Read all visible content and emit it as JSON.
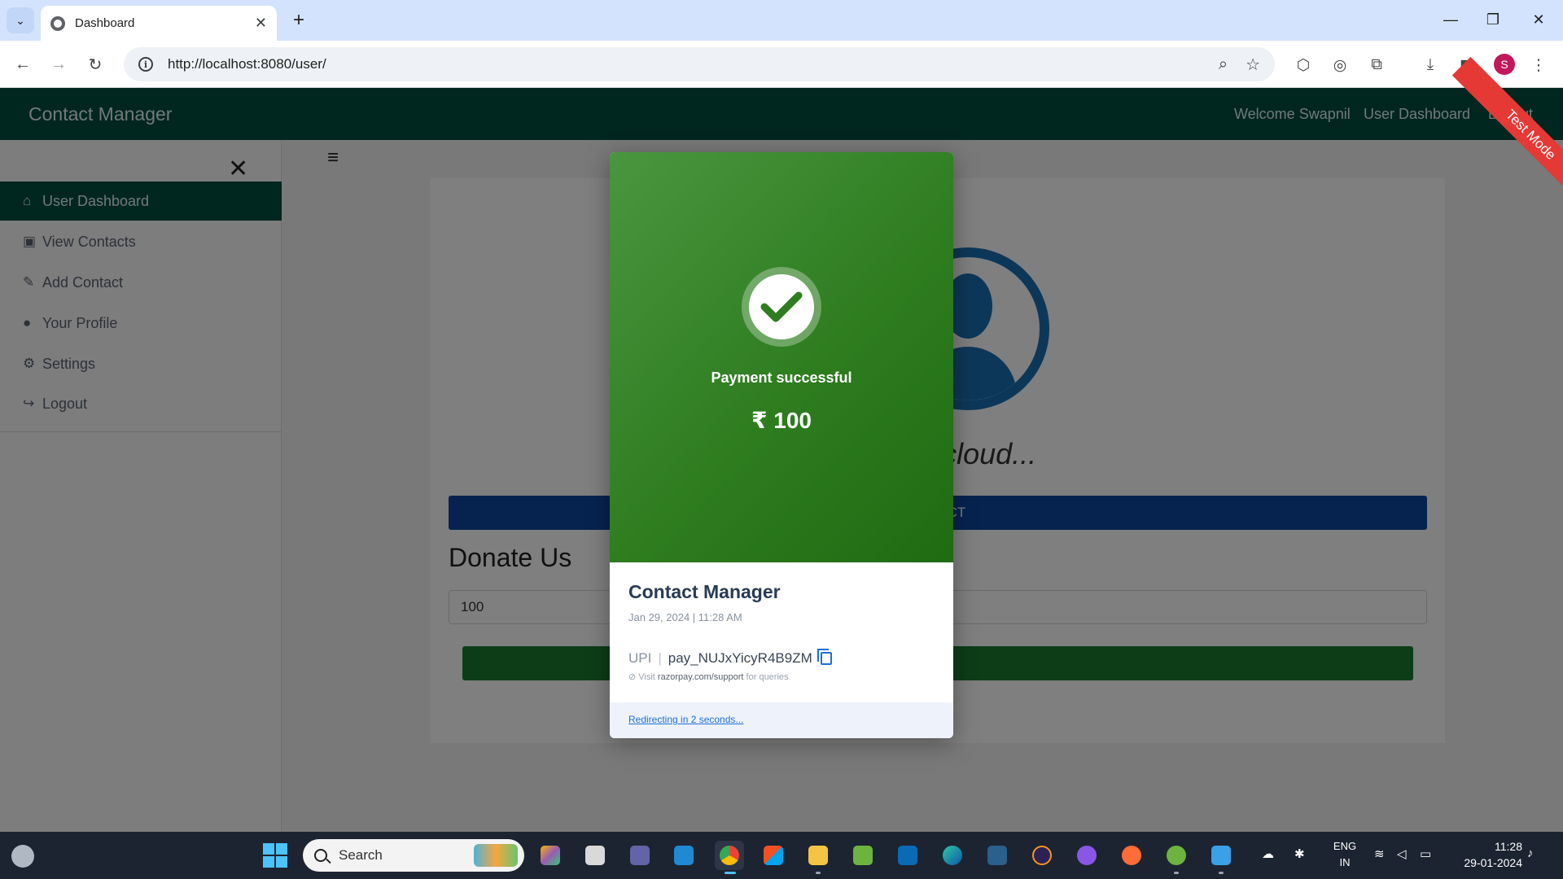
{
  "browser": {
    "tab_title": "Dashboard",
    "tab_close": "✕",
    "new_tab": "+",
    "url": "http://localhost:8080/user/",
    "profile_initial": "S"
  },
  "app": {
    "brand": "Contact Manager",
    "nav": {
      "welcome": "Welcome Swapnil",
      "dashboard": "User Dashboard",
      "logout": "Logout"
    },
    "ribbon": "Test Mode",
    "sidebar": {
      "close": "✕",
      "items": [
        {
          "label": "User Dashboard",
          "icon": "home-icon",
          "glyph": "⌂",
          "active": true
        },
        {
          "label": "View Contacts",
          "icon": "contacts-icon",
          "glyph": "▣",
          "active": false
        },
        {
          "label": "Add Contact",
          "icon": "pencil-icon",
          "glyph": "✎",
          "active": false
        },
        {
          "label": "Your Profile",
          "icon": "user-circle-icon",
          "glyph": "●",
          "active": false
        },
        {
          "label": "Settings",
          "icon": "gears-icon",
          "glyph": "⚙",
          "active": false
        },
        {
          "label": "Logout",
          "icon": "sign-out-icon",
          "glyph": "↪",
          "active": false
        }
      ]
    },
    "main": {
      "hamburger": "≡",
      "tagline": "ontact on cloud...",
      "add_button": "ONTACT",
      "donate_title": "Donate Us",
      "donate_value": "100"
    }
  },
  "payment": {
    "status": "Payment successful",
    "amount": "₹ 100",
    "merchant": "Contact Manager",
    "datetime": "Jan 29, 2024 | 11:28 AM",
    "method": "UPI",
    "payment_id": "pay_NUJxYicyR4B9ZM",
    "support_prefix": "⊘ Visit ",
    "support_link": "razorpay.com/support",
    "support_suffix": " for queries",
    "redirect": "Redirecting in 2 seconds..."
  },
  "taskbar": {
    "search": "Search",
    "lang_line1": "ENG",
    "lang_line2": "IN",
    "time": "11:28",
    "date": "29-01-2024"
  },
  "colors": {
    "navbar": "#004d40",
    "success_green": "#2e7d1f",
    "primary_blue": "#0d47a1",
    "ribbon_red": "#e53935"
  }
}
